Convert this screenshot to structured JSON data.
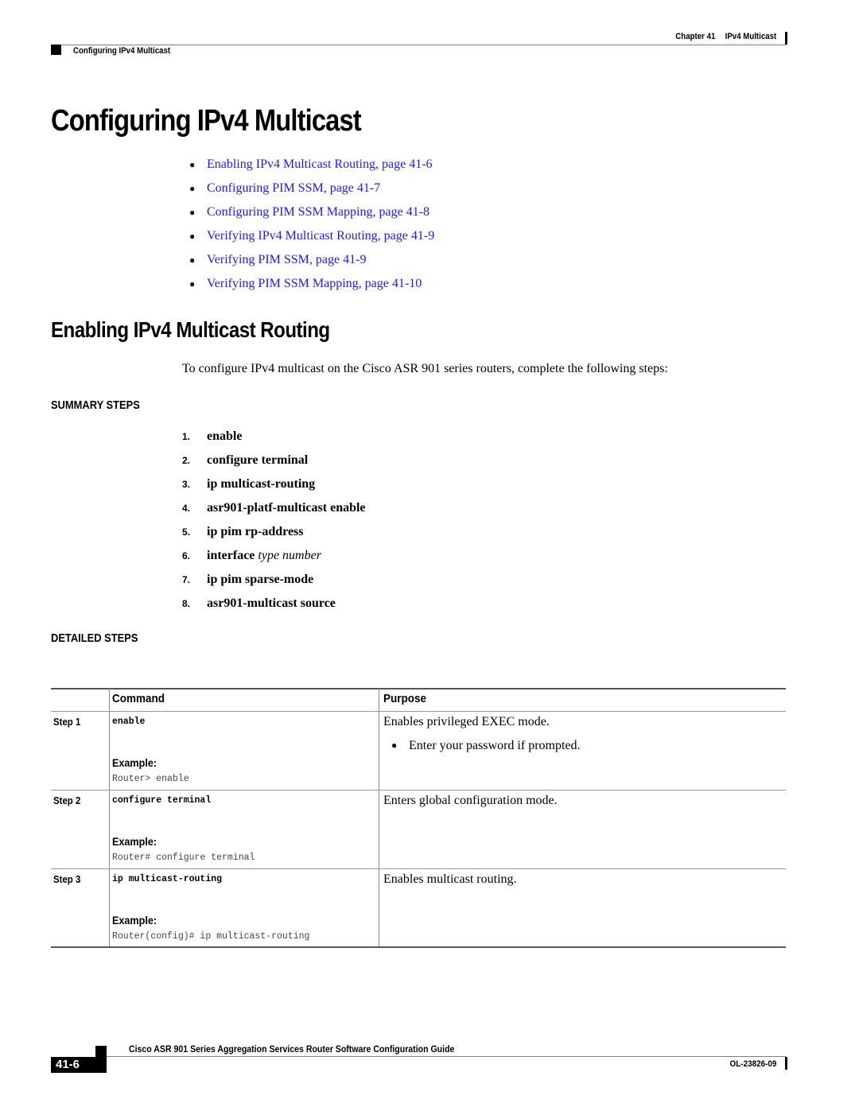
{
  "header": {
    "chapter_label": "Chapter 41",
    "chapter_title": "IPv4 Multicast",
    "section": "Configuring IPv4 Multicast"
  },
  "page_title": "Configuring IPv4 Multicast",
  "toc": [
    {
      "label": "Enabling IPv4 Multicast Routing, page 41-6"
    },
    {
      "label": "Configuring PIM SSM, page 41-7"
    },
    {
      "label": "Configuring PIM SSM Mapping, page 41-8"
    },
    {
      "label": "Verifying IPv4 Multicast Routing, page 41-9"
    },
    {
      "label": "Verifying PIM SSM, page 41-9"
    },
    {
      "label": "Verifying PIM SSM Mapping, page 41-10"
    }
  ],
  "section": {
    "title": "Enabling IPv4 Multicast Routing",
    "intro": "To configure IPv4 multicast on the Cisco ASR 901 series routers, complete the following steps:",
    "summary_heading": "SUMMARY STEPS",
    "summary_steps": [
      {
        "num": "1.",
        "cmd": "enable",
        "arg": ""
      },
      {
        "num": "2.",
        "cmd": "configure terminal",
        "arg": ""
      },
      {
        "num": "3.",
        "cmd": "ip multicast-routing",
        "arg": ""
      },
      {
        "num": "4.",
        "cmd": "asr901-platf-multicast enable",
        "arg": ""
      },
      {
        "num": "5.",
        "cmd": "ip pim rp-address",
        "arg": ""
      },
      {
        "num": "6.",
        "cmd": "interface",
        "arg": "type number"
      },
      {
        "num": "7.",
        "cmd": "ip pim sparse-mode",
        "arg": ""
      },
      {
        "num": "8.",
        "cmd": "asr901-multicast source",
        "arg": ""
      }
    ],
    "detailed_heading": "DETAILED STEPS"
  },
  "table": {
    "headers": {
      "command": "Command",
      "purpose": "Purpose"
    },
    "rows": [
      {
        "step": "Step 1",
        "command": "enable",
        "example_label": "Example:",
        "example": "Router> enable",
        "purpose": "Enables privileged EXEC mode.",
        "purpose_bullet": "Enter your password if prompted."
      },
      {
        "step": "Step 2",
        "command": "configure terminal",
        "example_label": "Example:",
        "example": "Router# configure terminal",
        "purpose": "Enters global configuration mode."
      },
      {
        "step": "Step 3",
        "command": "ip multicast-routing",
        "example_label": "Example:",
        "example": "Router(config)# ip multicast-routing",
        "purpose": "Enables multicast routing."
      }
    ]
  },
  "footer": {
    "guide_title": "Cisco ASR 901 Series Aggregation Services Router Software Configuration Guide",
    "page_number": "41-6",
    "doc_number": "OL-23826-09"
  },
  "colors": {
    "link": "#1a1aff",
    "text": "#000000"
  }
}
